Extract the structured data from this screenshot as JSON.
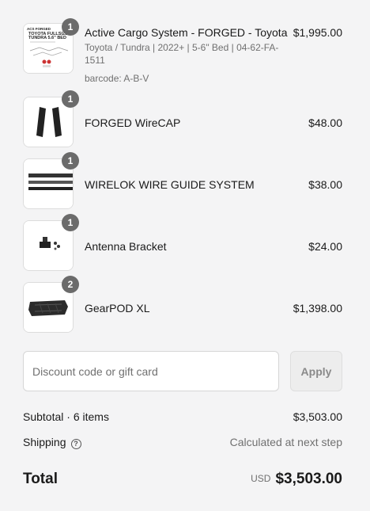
{
  "items": [
    {
      "quantity": "1",
      "title": "Active Cargo System - FORGED - Toyota",
      "variant": "Toyota / Tundra | 2022+ | 5-6\" Bed | 04-62-FA-1511",
      "barcode": "barcode: A-B-V",
      "price": "$1,995.00",
      "thumb_text": [
        "ACS FORGED",
        "TOYOTA FULLSIZE",
        "TUNDRA 5.6\" BED"
      ]
    },
    {
      "quantity": "1",
      "title": "FORGED WireCAP",
      "price": "$48.00"
    },
    {
      "quantity": "1",
      "title": "WIRELOK WIRE GUIDE SYSTEM",
      "price": "$38.00"
    },
    {
      "quantity": "1",
      "title": "Antenna Bracket",
      "price": "$24.00"
    },
    {
      "quantity": "2",
      "title": "GearPOD XL",
      "price": "$1,398.00"
    }
  ],
  "discount": {
    "placeholder": "Discount code or gift card",
    "apply_label": "Apply"
  },
  "summary": {
    "subtotal_label": "Subtotal · 6 items",
    "subtotal_value": "$3,503.00",
    "shipping_label": "Shipping",
    "shipping_value": "Calculated at next step",
    "total_label": "Total",
    "currency": "USD",
    "total_value": "$3,503.00"
  },
  "colors": {
    "background": "#f4f4f5",
    "badge": "#6b6b6b",
    "muted_text": "#707070"
  },
  "icons": {
    "shipping_help": "question-circle-icon"
  }
}
